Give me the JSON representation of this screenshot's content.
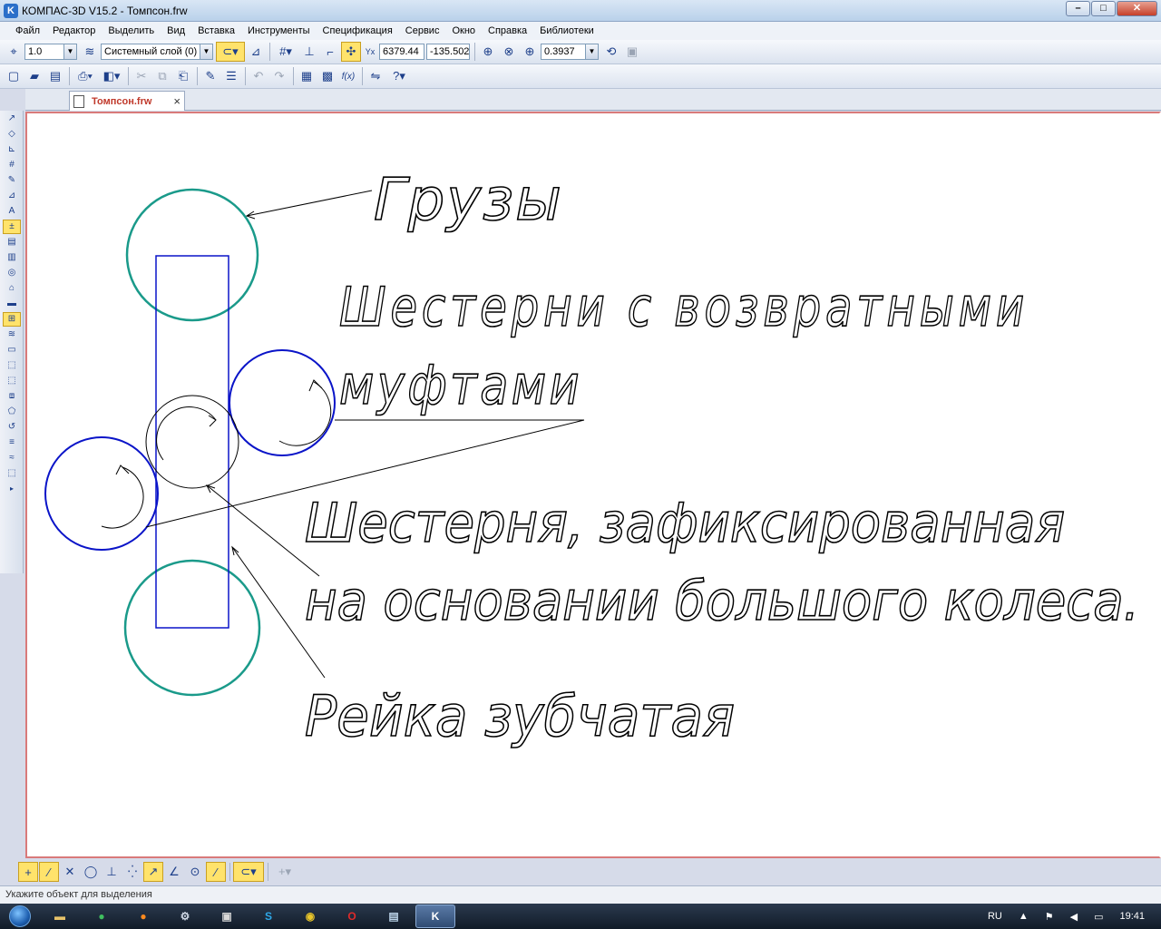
{
  "app": {
    "title": "КОМПАС-3D V15.2  - Томпсон.frw",
    "icon_label": "K",
    "window_buttons": [
      "–",
      "□",
      "✕"
    ]
  },
  "menu": [
    "Файл",
    "Редактор",
    "Выделить",
    "Вид",
    "Вставка",
    "Инструменты",
    "Спецификация",
    "Сервис",
    "Окно",
    "Справка",
    "Библиотеки"
  ],
  "toolbar1": {
    "step_value": "1.0",
    "layer_value": "Системный слой (0)",
    "coord_x": "6379.44",
    "coord_y": "-135.502",
    "zoom_value": "0.3937"
  },
  "document_tab": {
    "label": "Томпсон.frw",
    "close": "×"
  },
  "drawing": {
    "label_weights": "Грузы",
    "label_gears_line1": "Шестерни с возвратными",
    "label_gears_line2": "муфтами",
    "label_fixed_line1": "Шестерня, зафиксированная",
    "label_fixed_line2": "на основании большого колеса.",
    "label_rack": "Рейка зубчатая",
    "colors": {
      "weights": "#1a9a8a",
      "gears": "#0a14c8",
      "rack": "#0a14c8",
      "leaders": "#000000"
    }
  },
  "status": {
    "hint": "Укажите объект для выделения"
  },
  "taskbar": {
    "language": "RU",
    "time": "19:41"
  }
}
